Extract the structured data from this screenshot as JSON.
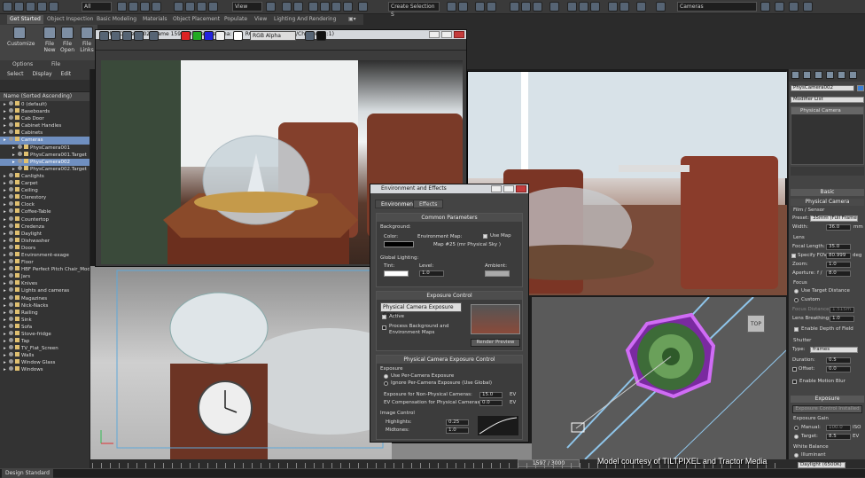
{
  "toolbar": {
    "selection_filter": "All",
    "view_label": "View",
    "selection_set": "Create Selection S",
    "layer": "Cameras"
  },
  "ribbon": {
    "tabs": [
      "Get Started",
      "Object Inspection",
      "Basic Modeling",
      "Materials",
      "Object Placement",
      "Populate",
      "View",
      "Lighting And Rendering"
    ],
    "buttons": [
      {
        "label": "Customize"
      },
      {
        "label": "File New"
      },
      {
        "label": "File Open"
      },
      {
        "label": "File Links"
      }
    ],
    "groups": [
      "Options",
      "File"
    ]
  },
  "explorer": {
    "tabs": [
      "Select",
      "Display",
      "Edit"
    ],
    "header": "Name (Sorted Ascending)",
    "items": [
      {
        "label": "0 (default)",
        "indent": 0,
        "selected": false
      },
      {
        "label": "Baseboards",
        "indent": 0,
        "selected": false
      },
      {
        "label": "Cab Door",
        "indent": 0,
        "selected": false
      },
      {
        "label": "Cabinet Handles",
        "indent": 0,
        "selected": false
      },
      {
        "label": "Cabinets",
        "indent": 0,
        "selected": false
      },
      {
        "label": "Cameras",
        "indent": 0,
        "selected": true
      },
      {
        "label": "PhysCamera001",
        "indent": 1,
        "selected": false
      },
      {
        "label": "PhysCamera001.Target",
        "indent": 1,
        "selected": false
      },
      {
        "label": "PhysCamera002",
        "indent": 1,
        "selected": true
      },
      {
        "label": "PhysCamera002.Target",
        "indent": 1,
        "selected": false
      },
      {
        "label": "Canlights",
        "indent": 0,
        "selected": false
      },
      {
        "label": "Carpet",
        "indent": 0,
        "selected": false
      },
      {
        "label": "Ceiling",
        "indent": 0,
        "selected": false
      },
      {
        "label": "Clerestory",
        "indent": 0,
        "selected": false
      },
      {
        "label": "Clock",
        "indent": 0,
        "selected": false
      },
      {
        "label": "Coffee-Table",
        "indent": 0,
        "selected": false
      },
      {
        "label": "Countertop",
        "indent": 0,
        "selected": false
      },
      {
        "label": "Credenza",
        "indent": 0,
        "selected": false
      },
      {
        "label": "Daylight",
        "indent": 0,
        "selected": false
      },
      {
        "label": "Dishwasher",
        "indent": 0,
        "selected": false
      },
      {
        "label": "Doors",
        "indent": 0,
        "selected": false
      },
      {
        "label": "Environment-exage",
        "indent": 0,
        "selected": false
      },
      {
        "label": "Floor",
        "indent": 0,
        "selected": false
      },
      {
        "label": "HBF Perfect Pitch Chair_Mod",
        "indent": 0,
        "selected": false
      },
      {
        "label": "Jars",
        "indent": 0,
        "selected": false
      },
      {
        "label": "Knives",
        "indent": 0,
        "selected": false
      },
      {
        "label": "Lights and cameras",
        "indent": 0,
        "selected": false
      },
      {
        "label": "Magazines",
        "indent": 0,
        "selected": false
      },
      {
        "label": "Nick-Nacks",
        "indent": 0,
        "selected": false
      },
      {
        "label": "Railing",
        "indent": 0,
        "selected": false
      },
      {
        "label": "Sink",
        "indent": 0,
        "selected": false
      },
      {
        "label": "Sofa",
        "indent": 0,
        "selected": false
      },
      {
        "label": "Stove-fridge",
        "indent": 0,
        "selected": false
      },
      {
        "label": "Tap",
        "indent": 0,
        "selected": false
      },
      {
        "label": "TV_Flat_Screen",
        "indent": 0,
        "selected": false
      },
      {
        "label": "Walls",
        "indent": 0,
        "selected": false
      },
      {
        "label": "Window Glass",
        "indent": 0,
        "selected": false
      },
      {
        "label": "Windows",
        "indent": 0,
        "selected": false
      }
    ]
  },
  "render_frame": {
    "title": "PhysCamera002, frame 1597, Display Gamma: 2.2, RGBA Color 32 Bits/Channel (1:1)",
    "channel": "RGB Alpha"
  },
  "env_dialog": {
    "title": "Environment and Effects",
    "tabs": [
      "Environment",
      "Effects"
    ],
    "common_params": {
      "header": "Common Parameters",
      "background": "Background:",
      "color": "Color:",
      "env_map": "Environment Map:",
      "use_map": "Use Map",
      "map_name": "Map #25 (mr Physical Sky )",
      "global_lighting": "Global Lighting:",
      "tint": "Tint:",
      "level": "Level:",
      "level_value": "1.0",
      "ambient": "Ambient:"
    },
    "exposure_control": {
      "header": "Exposure Control",
      "type": "Physical Camera Exposure Contr",
      "active": "Active",
      "process_bg": "Process Background and Environment Maps",
      "render_preview": "Render Preview"
    },
    "pce": {
      "header": "Physical Camera Exposure Control",
      "exposure": "Exposure",
      "use_per_camera": "Use Per-Camera Exposure",
      "ignore_per_camera": "Ignore Per-Camera Exposure (Use Global)",
      "exp_non_phys": "Exposure for Non-Physical Cameras:",
      "exp_non_phys_val": "15.0",
      "ev_comp": "EV Compensation for Physical Cameras:",
      "ev_comp_val": "0.0",
      "ev": "EV",
      "image_control": "Image Control",
      "highlights": "Highlights:",
      "highlights_val": "0.25",
      "midtones": "Midtones:",
      "midtones_val": "1.0"
    }
  },
  "command_panel": {
    "object_name": "PhysCamera002",
    "modifier_list": "Modifier List",
    "stack_item": "Physical Camera",
    "basic_header": "Basic",
    "physical_camera_header": "Physical Camera",
    "film_sensor": "Film / Sensor",
    "preset_label": "Preset:",
    "preset_value": "35mm (Full Frame",
    "width_label": "Width:",
    "width_value": "36.0",
    "width_unit": "mm",
    "lens_label": "Lens",
    "focal_length_label": "Focal Length:",
    "focal_length_value": "35.0",
    "specify_fov": "Specify FOV:",
    "fov_value": "80.999",
    "fov_unit": "deg",
    "zoom_label": "Zoom:",
    "zoom_value": "1.0",
    "aperture_label": "Aperture:",
    "aperture_prefix": "f /",
    "aperture_value": "8.0",
    "focus_label": "Focus",
    "use_target_distance": "Use Target Distance",
    "custom": "Custom",
    "focus_distance_label": "Focus Distance:",
    "focus_distance_value": "1.515m",
    "lens_breathing_label": "Lens Breathing:",
    "lens_breathing_value": "1.0",
    "enable_dof": "Enable Depth of Field",
    "shutter_label": "Shutter",
    "type_label": "Type:",
    "type_value": "frames",
    "duration_label": "Duration:",
    "duration_value": "0.5",
    "offset_label": "Offset:",
    "offset_value": "0.0",
    "enable_motion_blur": "Enable Motion Blur",
    "exposure_header": "Exposure",
    "exposure_control_installed": "Exposure Control Installed",
    "exposure_gain_label": "Exposure Gain",
    "manual_label": "Manual:",
    "manual_value": "100.0",
    "manual_unit": "ISO",
    "target_label": "Target:",
    "target_value": "8.5",
    "target_unit": "EV",
    "white_balance_label": "White Balance",
    "illuminant_label": "Illuminant",
    "illuminant_value": "Daylight (6500K)"
  },
  "viewport": {
    "top_label": "TOP"
  },
  "timeline": {
    "frame": "1597 / 3000"
  },
  "status": {
    "label": "Design Standard"
  },
  "credit": "Model courtesy of TILTPIXEL and Tractor Media"
}
